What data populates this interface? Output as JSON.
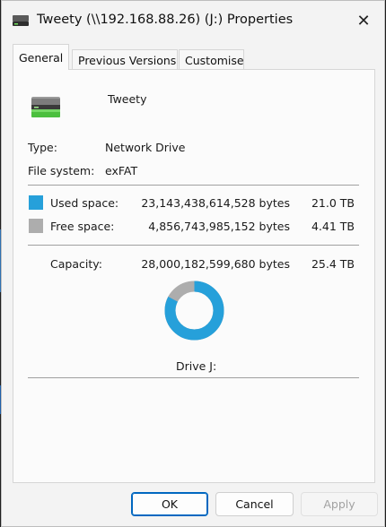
{
  "window": {
    "title": "Tweety (\\\\192.168.88.26) (J:) Properties"
  },
  "tabs": [
    {
      "label": "General",
      "active": true
    },
    {
      "label": "Previous Versions",
      "active": false
    },
    {
      "label": "Customise",
      "active": false
    }
  ],
  "drive": {
    "name": "Tweety",
    "type_label": "Type:",
    "type_value": "Network Drive",
    "fs_label": "File system:",
    "fs_value": "exFAT"
  },
  "space": {
    "used_label": "Used space:",
    "used_bytes": "23,143,438,614,528 bytes",
    "used_size": "21.0 TB",
    "free_label": "Free space:",
    "free_bytes": "4,856,743,985,152 bytes",
    "free_size": "4.41 TB",
    "capacity_label": "Capacity:",
    "capacity_bytes": "28,000,182,599,680 bytes",
    "capacity_size": "25.4 TB",
    "used_fraction": 0.8265,
    "used_color": "#26a0da",
    "free_color": "#adadad"
  },
  "drive_label": "Drive J:",
  "buttons": {
    "ok": "OK",
    "cancel": "Cancel",
    "apply": "Apply"
  }
}
